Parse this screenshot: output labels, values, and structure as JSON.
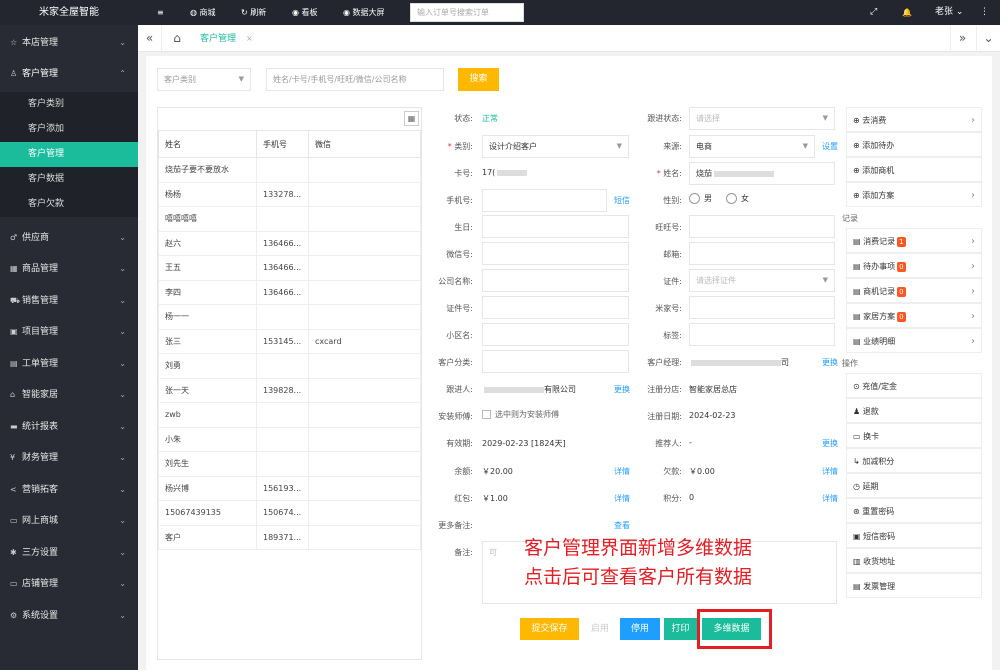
{
  "brand": "米家全屋智能",
  "topnav": [
    {
      "icon": "≡",
      "label": ""
    },
    {
      "icon": "◍",
      "label": "商城"
    },
    {
      "icon": "↻",
      "label": "刷新"
    },
    {
      "icon": "◉",
      "label": "看板"
    },
    {
      "icon": "◉",
      "label": "数据大屏"
    }
  ],
  "top_search_placeholder": "输入订单号搜索订单",
  "top_right": {
    "fullscreen": "⤢",
    "bell": "🔔",
    "user": "老张"
  },
  "sidebar": {
    "menus": [
      {
        "label": "本店管理",
        "icon": "☆"
      },
      {
        "label": "客户管理",
        "icon": "♙"
      },
      {
        "label": "供应商",
        "icon": "♂"
      },
      {
        "label": "商品管理",
        "icon": "▦"
      },
      {
        "label": "销售管理",
        "icon": "⛟"
      },
      {
        "label": "项目管理",
        "icon": "▣"
      },
      {
        "label": "工单管理",
        "icon": "▤"
      },
      {
        "label": "智能家居",
        "icon": "⌂"
      },
      {
        "label": "统计报表",
        "icon": "▬"
      },
      {
        "label": "财务管理",
        "icon": "¥"
      },
      {
        "label": "营销拓客",
        "icon": "<"
      },
      {
        "label": "网上商城",
        "icon": "▭"
      },
      {
        "label": "三方设置",
        "icon": "✱"
      },
      {
        "label": "店铺管理",
        "icon": "▭"
      },
      {
        "label": "系统设置",
        "icon": "⚙"
      }
    ],
    "submenus": [
      "客户类别",
      "客户添加",
      "客户管理",
      "客户数据",
      "客户欠款"
    ]
  },
  "tabbar": {
    "back": "«",
    "home": "⌂",
    "active_tab": "客户管理",
    "close": "×",
    "forward": "»",
    "more": "⌄"
  },
  "filter": {
    "category_placeholder": "客户类别",
    "search_placeholder": "姓名/卡号/手机号/旺旺/微信/公司名称",
    "search_button": "搜索"
  },
  "list": {
    "headers": [
      "姓名",
      "手机号",
      "微信"
    ],
    "rows": [
      [
        "烧茄子要不要放水",
        "",
        ""
      ],
      [
        "杨杨",
        "133278...",
        ""
      ],
      [
        "嘻嘻嘻嘻",
        "",
        ""
      ],
      [
        "赵六",
        "136466...",
        ""
      ],
      [
        "王五",
        "136466...",
        ""
      ],
      [
        "李四",
        "136466...",
        ""
      ],
      [
        "杨一一",
        "",
        ""
      ],
      [
        "张三",
        "153145...",
        "cxcard"
      ],
      [
        "刘勇",
        "",
        ""
      ],
      [
        "张一天",
        "139828...",
        ""
      ],
      [
        "zwb",
        "",
        ""
      ],
      [
        "小朱",
        "",
        ""
      ],
      [
        "刘先生",
        "",
        ""
      ],
      [
        "杨兴博",
        "156193...",
        ""
      ],
      [
        "15067439135",
        "150674...",
        ""
      ],
      [
        "客户",
        "189371...",
        ""
      ]
    ]
  },
  "form": {
    "status_label": "状态:",
    "status_value": "正常",
    "follow_label": "跟进状态:",
    "follow_placeholder": "请选择",
    "type_label": "类别:",
    "type_value": "设计介绍客户",
    "source_label": "来源:",
    "source_value": "电商",
    "source_link": "设置",
    "card_label": "卡号:",
    "card_value": "17(",
    "name_label": "姓名:",
    "name_value": "烧茄",
    "phone_label": "手机号:",
    "phone_link": "短信",
    "gender_label": "性别:",
    "gender_male": "男",
    "gender_female": "女",
    "birthday_label": "生日:",
    "wangwang_label": "旺旺号:",
    "wechat_label": "微信号:",
    "email_label": "邮箱:",
    "company_label": "公司名称:",
    "cert_label": "证件:",
    "cert_placeholder": "请选择证件",
    "certno_label": "证件号:",
    "mijia_label": "米家号:",
    "community_label": "小区名:",
    "tags_label": "标签:",
    "custcat_label": "客户分类:",
    "manager_label": "客户经理:",
    "manager_value": "司",
    "manager_link": "更换",
    "follower_label": "跟进人:",
    "follower_value": "有限公司",
    "follower_link": "更换",
    "branch_label": "注册分店:",
    "branch_value": "智能家居总店",
    "installer_label": "安装师傅:",
    "installer_value": "选中则为安装师傅",
    "regdate_label": "注册日期:",
    "regdate_value": "2024-02-23",
    "valid_label": "有效期:",
    "valid_value": "2029-02-23 [1824天]",
    "referrer_label": "推荐人:",
    "referrer_value": "-",
    "referrer_link": "更换",
    "balance_label": "余额:",
    "balance_value": "￥20.00",
    "balance_link": "详情",
    "debt_label": "欠款:",
    "debt_value": "￥0.00",
    "debt_link": "详情",
    "redpack_label": "红包:",
    "redpack_value": "￥1.00",
    "redpack_link": "详情",
    "points_label": "积分:",
    "points_value": "0",
    "points_link": "详情",
    "notes_label": "更多备注:",
    "notes_link": "查看",
    "remark_label": "备注:",
    "remark_placeholder": "可"
  },
  "actions": {
    "submit": "提交保存",
    "enable": "启用",
    "disable": "停用",
    "print": "打印",
    "multidim": "多维数据"
  },
  "right_panel": {
    "top_items": [
      "去消费",
      "添加待办",
      "添加商机",
      "添加方案"
    ],
    "records_title": "记录",
    "records": [
      {
        "label": "消费记录",
        "badge": "1"
      },
      {
        "label": "待办事项",
        "badge": "0"
      },
      {
        "label": "商机记录",
        "badge": "0"
      },
      {
        "label": "家居方案",
        "badge": "0"
      },
      {
        "label": "业绩明细",
        "badge": ""
      }
    ],
    "ops_title": "操作",
    "ops": [
      "充值/定金",
      "退款",
      "换卡",
      "加减积分",
      "延期",
      "重置密码",
      "短信密码",
      "收货地址",
      "发票管理"
    ]
  },
  "annotation": {
    "line1": "客户管理界面新增多维数据",
    "line2": "点击后可查看客户所有数据"
  },
  "colors": {
    "sidebar": "#282b33",
    "active": "#1abc9c",
    "submit": "#ffb800",
    "blue": "#1e9fff",
    "annot": "#e31e24"
  }
}
